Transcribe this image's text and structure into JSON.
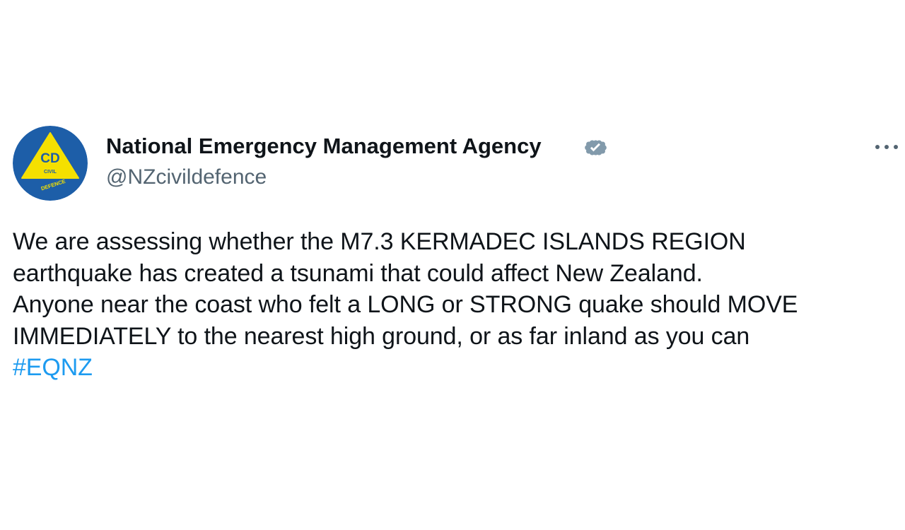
{
  "author": {
    "name": "National Emergency Management Agency",
    "handle": "@NZcivildefence",
    "verified_icon": "verified-badge-icon",
    "verified_color": "#829aab",
    "avatar": {
      "icon": "civil-defence-logo",
      "monogram": "CD",
      "ring_text_top": "CIVIL",
      "ring_text_bottom": "DEFENCE",
      "circle_color": "#1d5ea8",
      "triangle_color": "#f5e000"
    }
  },
  "more_menu": {
    "icon": "more-horizontal-icon"
  },
  "tweet": {
    "lines": [
      "We are assessing whether the M7.3 KERMADEC ISLANDS REGION",
      "earthquake has created a tsunami that could affect New Zealand.",
      "Anyone near the coast who felt a LONG or STRONG quake should MOVE",
      "IMMEDIATELY to the nearest high ground, or as far inland as you can"
    ],
    "hashtag": "#EQNZ",
    "hashtag_color": "#1d9bf0",
    "text_color": "#0f1419",
    "handle_color": "#536471"
  }
}
